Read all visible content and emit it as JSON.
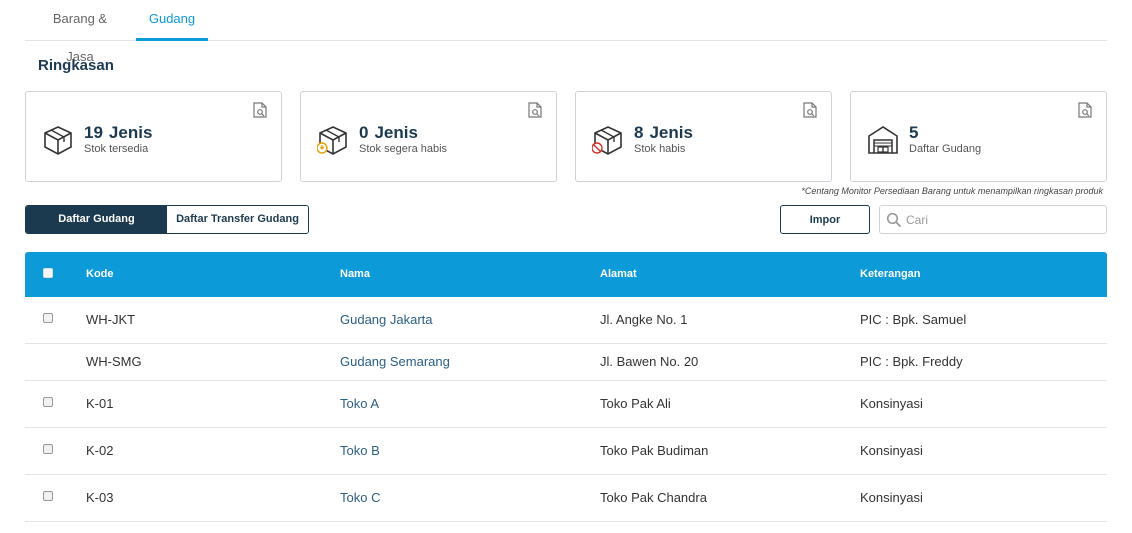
{
  "tabs": [
    {
      "label": "Barang & Jasa",
      "active": false
    },
    {
      "label": "Gudang",
      "active": true
    }
  ],
  "summary": {
    "title": "Ringkasan",
    "cards": [
      {
        "value": "19",
        "unit": "Jenis",
        "label": "Stok tersedia",
        "icon": "box-icon"
      },
      {
        "value": "0",
        "unit": "Jenis",
        "label": "Stok segera habis",
        "icon": "box-warning-icon"
      },
      {
        "value": "8",
        "unit": "Jenis",
        "label": "Stok habis",
        "icon": "box-empty-icon"
      },
      {
        "value": "5",
        "unit": "",
        "label": "Daftar Gudang",
        "icon": "warehouse-icon"
      }
    ],
    "note": "*Centang Monitor Persediaan Barang untuk menampilkan ringkasan produk"
  },
  "toolbar": {
    "segments": [
      "Daftar Gudang",
      "Daftar Transfer Gudang"
    ],
    "import_label": "Impor",
    "search_placeholder": "Cari"
  },
  "table": {
    "headers": [
      "Kode",
      "Nama",
      "Alamat",
      "Keterangan"
    ],
    "rows": [
      {
        "kode": "WH-JKT",
        "nama": "Gudang Jakarta",
        "alamat": "Jl. Angke No. 1",
        "keterangan": "PIC : Bpk. Samuel",
        "checkbox": true
      },
      {
        "kode": "WH-SMG",
        "nama": "Gudang Semarang",
        "alamat": "Jl. Bawen No. 20",
        "keterangan": "PIC : Bpk. Freddy",
        "checkbox": false
      },
      {
        "kode": "K-01",
        "nama": "Toko A",
        "alamat": "Toko Pak Ali",
        "keterangan": "Konsinyasi",
        "checkbox": true
      },
      {
        "kode": "K-02",
        "nama": "Toko B",
        "alamat": "Toko Pak Budiman",
        "keterangan": "Konsinyasi",
        "checkbox": true
      },
      {
        "kode": "K-03",
        "nama": "Toko C",
        "alamat": "Toko Pak Chandra",
        "keterangan": "Konsinyasi",
        "checkbox": true
      }
    ]
  },
  "colors": {
    "primary": "#1c3a4f",
    "accent": "#0d9ad8",
    "link": "#2a5f86"
  }
}
